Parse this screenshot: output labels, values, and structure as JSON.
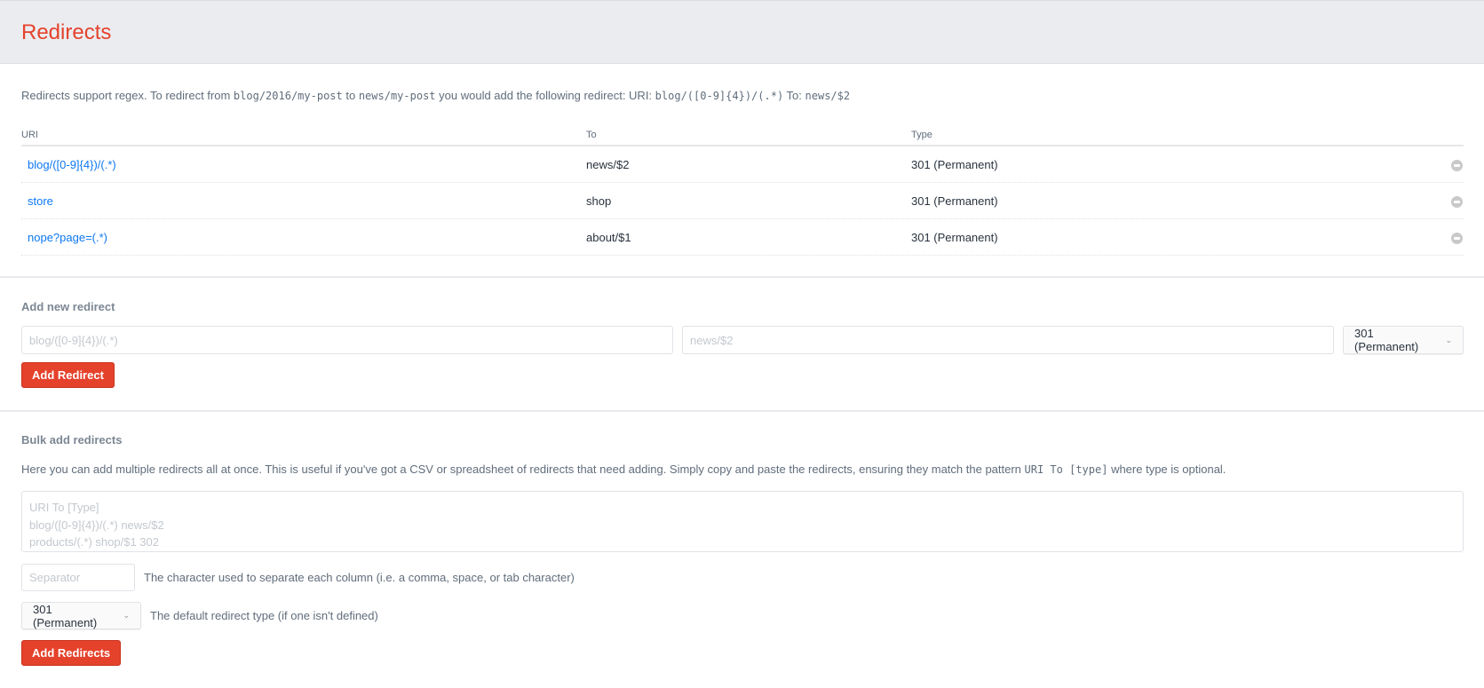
{
  "header": {
    "title": "Redirects"
  },
  "intro": {
    "text_1": "Redirects support regex. To redirect from ",
    "code_from": "blog/2016/my-post",
    "text_2": " to ",
    "code_to": "news/my-post",
    "text_3": " you would add the following redirect: URI: ",
    "code_uri": "blog/([0-9]{4})/(.*)",
    "text_4": " To: ",
    "code_dest": "news/$2"
  },
  "table": {
    "columns": {
      "uri": "URI",
      "to": "To",
      "type": "Type"
    },
    "rows": [
      {
        "uri": "blog/([0-9]{4})/(.*)",
        "to": "news/$2",
        "type": "301 (Permanent)"
      },
      {
        "uri": "store",
        "to": "shop",
        "type": "301 (Permanent)"
      },
      {
        "uri": "nope?page=(.*)",
        "to": "about/$1",
        "type": "301 (Permanent)"
      }
    ],
    "remove_icon": "minus-circle-icon"
  },
  "add_new": {
    "title": "Add new redirect",
    "uri_placeholder": "blog/([0-9]{4})/(.*)",
    "uri_value": "",
    "to_placeholder": "news/$2",
    "to_value": "",
    "type_selected": "301 (Permanent)",
    "button_label": "Add Redirect"
  },
  "bulk": {
    "title": "Bulk add redirects",
    "desc_1": "Here you can add multiple redirects all at once. This is useful if you've got a CSV or spreadsheet of redirects that need adding. Simply copy and paste the redirects, ensuring they match the pattern ",
    "desc_code": "URI To [type]",
    "desc_2": " where type is optional.",
    "textarea_placeholder": "URI To [Type]\nblog/([0-9]{4})/(.*) news/$2\nproducts/(.*) shop/$1 302",
    "textarea_value": "",
    "separator_placeholder": "Separator",
    "separator_value": "",
    "separator_help": "The character used to separate each column (i.e. a comma, space, or tab character)",
    "type_selected": "301 (Permanent)",
    "type_help": "The default redirect type (if one isn't defined)",
    "button_label": "Add Redirects"
  },
  "colors": {
    "brand_red": "#e5422b",
    "link_blue": "#0d78f2",
    "header_bg": "#ebecf0"
  }
}
